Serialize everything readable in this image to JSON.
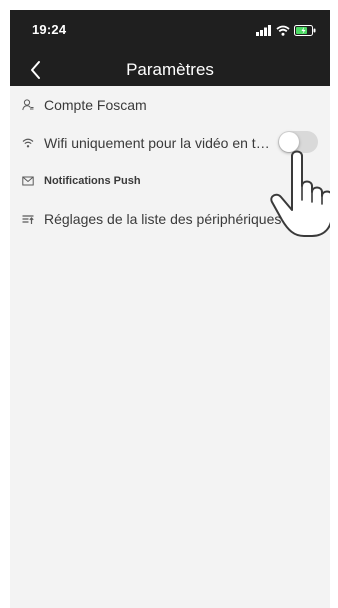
{
  "status_bar": {
    "time": "19:24",
    "icons": [
      "signal-icon",
      "wifi-icon",
      "battery-icon"
    ]
  },
  "nav": {
    "title": "Paramètres",
    "back_icon": "chevron-left-icon"
  },
  "menu": {
    "items": [
      {
        "label": "Compte Foscam",
        "icon": "user-icon"
      },
      {
        "label": "Wifi uniquement pour la vidéo en temps réel",
        "icon": "wifi-icon",
        "toggle": {
          "on": false
        }
      },
      {
        "label": "Notifications Push",
        "icon": "message-icon"
      },
      {
        "label": "Réglages de la liste des périphériques",
        "icon": "list-sort-icon"
      }
    ]
  },
  "overlay": {
    "icon": "pointing-hand-icon"
  },
  "colors": {
    "header_bg": "#1f1f1f",
    "content_bg": "#f3f3f3",
    "text": "#3a3a3a",
    "toggle_off": "#d9d9d9",
    "battery_green": "#4cd964"
  }
}
